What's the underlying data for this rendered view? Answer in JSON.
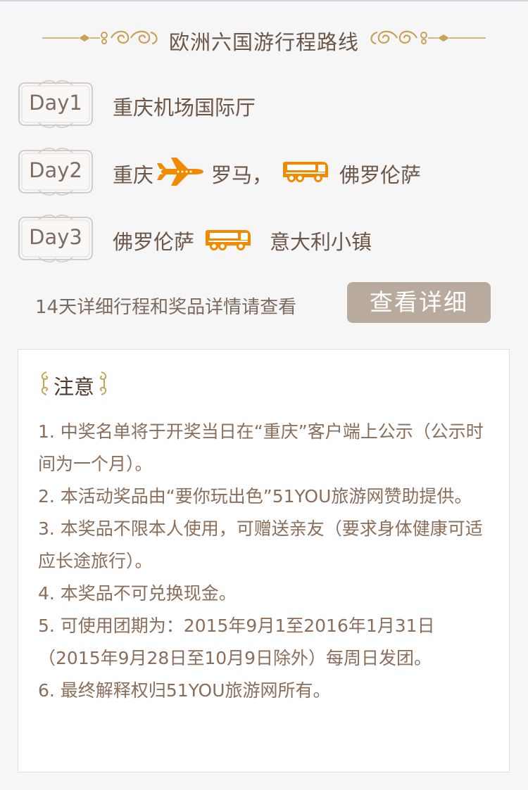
{
  "title": "欧洲六国游行程路线",
  "days": [
    {
      "label": "Day1",
      "segments": [
        {
          "type": "text",
          "value": "重庆机场国际厅"
        }
      ]
    },
    {
      "label": "Day2",
      "segments": [
        {
          "type": "text",
          "value": "重庆"
        },
        {
          "type": "icon",
          "icon": "airplane-icon"
        },
        {
          "type": "text",
          "value": "罗马，"
        },
        {
          "type": "icon",
          "icon": "bus-icon"
        },
        {
          "type": "text",
          "value": "佛罗伦萨"
        }
      ]
    },
    {
      "label": "Day3",
      "segments": [
        {
          "type": "text",
          "value": "佛罗伦萨"
        },
        {
          "type": "icon",
          "icon": "bus-icon"
        },
        {
          "type": "text",
          "value": "意大利小镇"
        }
      ]
    }
  ],
  "detail_prompt": "14天详细行程和奖品详情请查看",
  "detail_button": "查看详细",
  "notice": {
    "title": "注意",
    "items": [
      "1.  中奖名单将于开奖当日在“重庆”客户端上公示（公示时间为一个月）。",
      "2.  本活动奖品由“要你玩出色”51YOU旅游网赞助提供。",
      "3.  本奖品不限本人使用，可赠送亲友（要求身体健康可适应长途旅行）。",
      "4.  本奖品不可兑换现金。",
      "5.  可使用团期为：2015年9月1至2016年1月31日（2015年9月28日至10月9日除外）每周日发团。",
      "6.  最终解释权归51YOU旅游网所有。"
    ]
  },
  "colors": {
    "ornament": "#c9a25a",
    "icon_orange": "#f08a00",
    "button_bg": "#b8ab9e",
    "text_main": "#6b5647",
    "notice_text": "#8a6e5a"
  }
}
